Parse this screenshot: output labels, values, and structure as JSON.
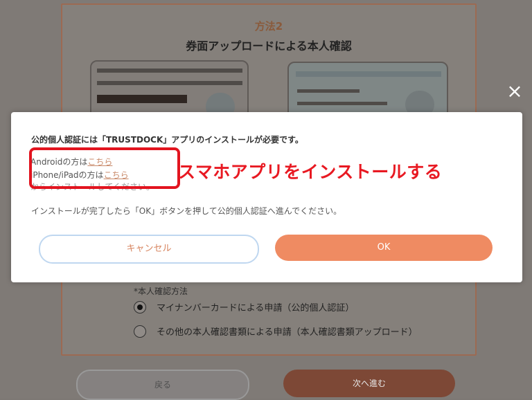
{
  "background": {
    "method": "方法2",
    "title": "券面アップロードによる本人確認",
    "section_label": "*本人確認方法",
    "options": [
      "マイナンバーカードによる申請（公的個人認証）",
      "その他の本人確認書類による申請（本人確認書類アップロード）"
    ],
    "buttons": {
      "back": "戻る",
      "next": "次へ進む"
    }
  },
  "modal": {
    "headline": "公的個人認証には「TRUSTDOCK」アプリのインストールが必要です。",
    "android_prefix": "Androidの方は",
    "android_link": "こちら",
    "iphone_prefix": "iPhone/iPadの方は",
    "iphone_link": "こちら",
    "partial_hidden": "からインストールしてください。",
    "note": "インストールが完了したら「OK」ボタンを押して公的個人認証へ進んでください。",
    "cancel": "キャンセル",
    "ok": "OK",
    "callout": "スマホアプリをインストールする"
  },
  "icons": {
    "close": "close-icon"
  },
  "colors": {
    "accent": "#ef8b62",
    "highlight": "#e2141f",
    "callout": "#e81922",
    "overlay": "#7f7a76"
  }
}
